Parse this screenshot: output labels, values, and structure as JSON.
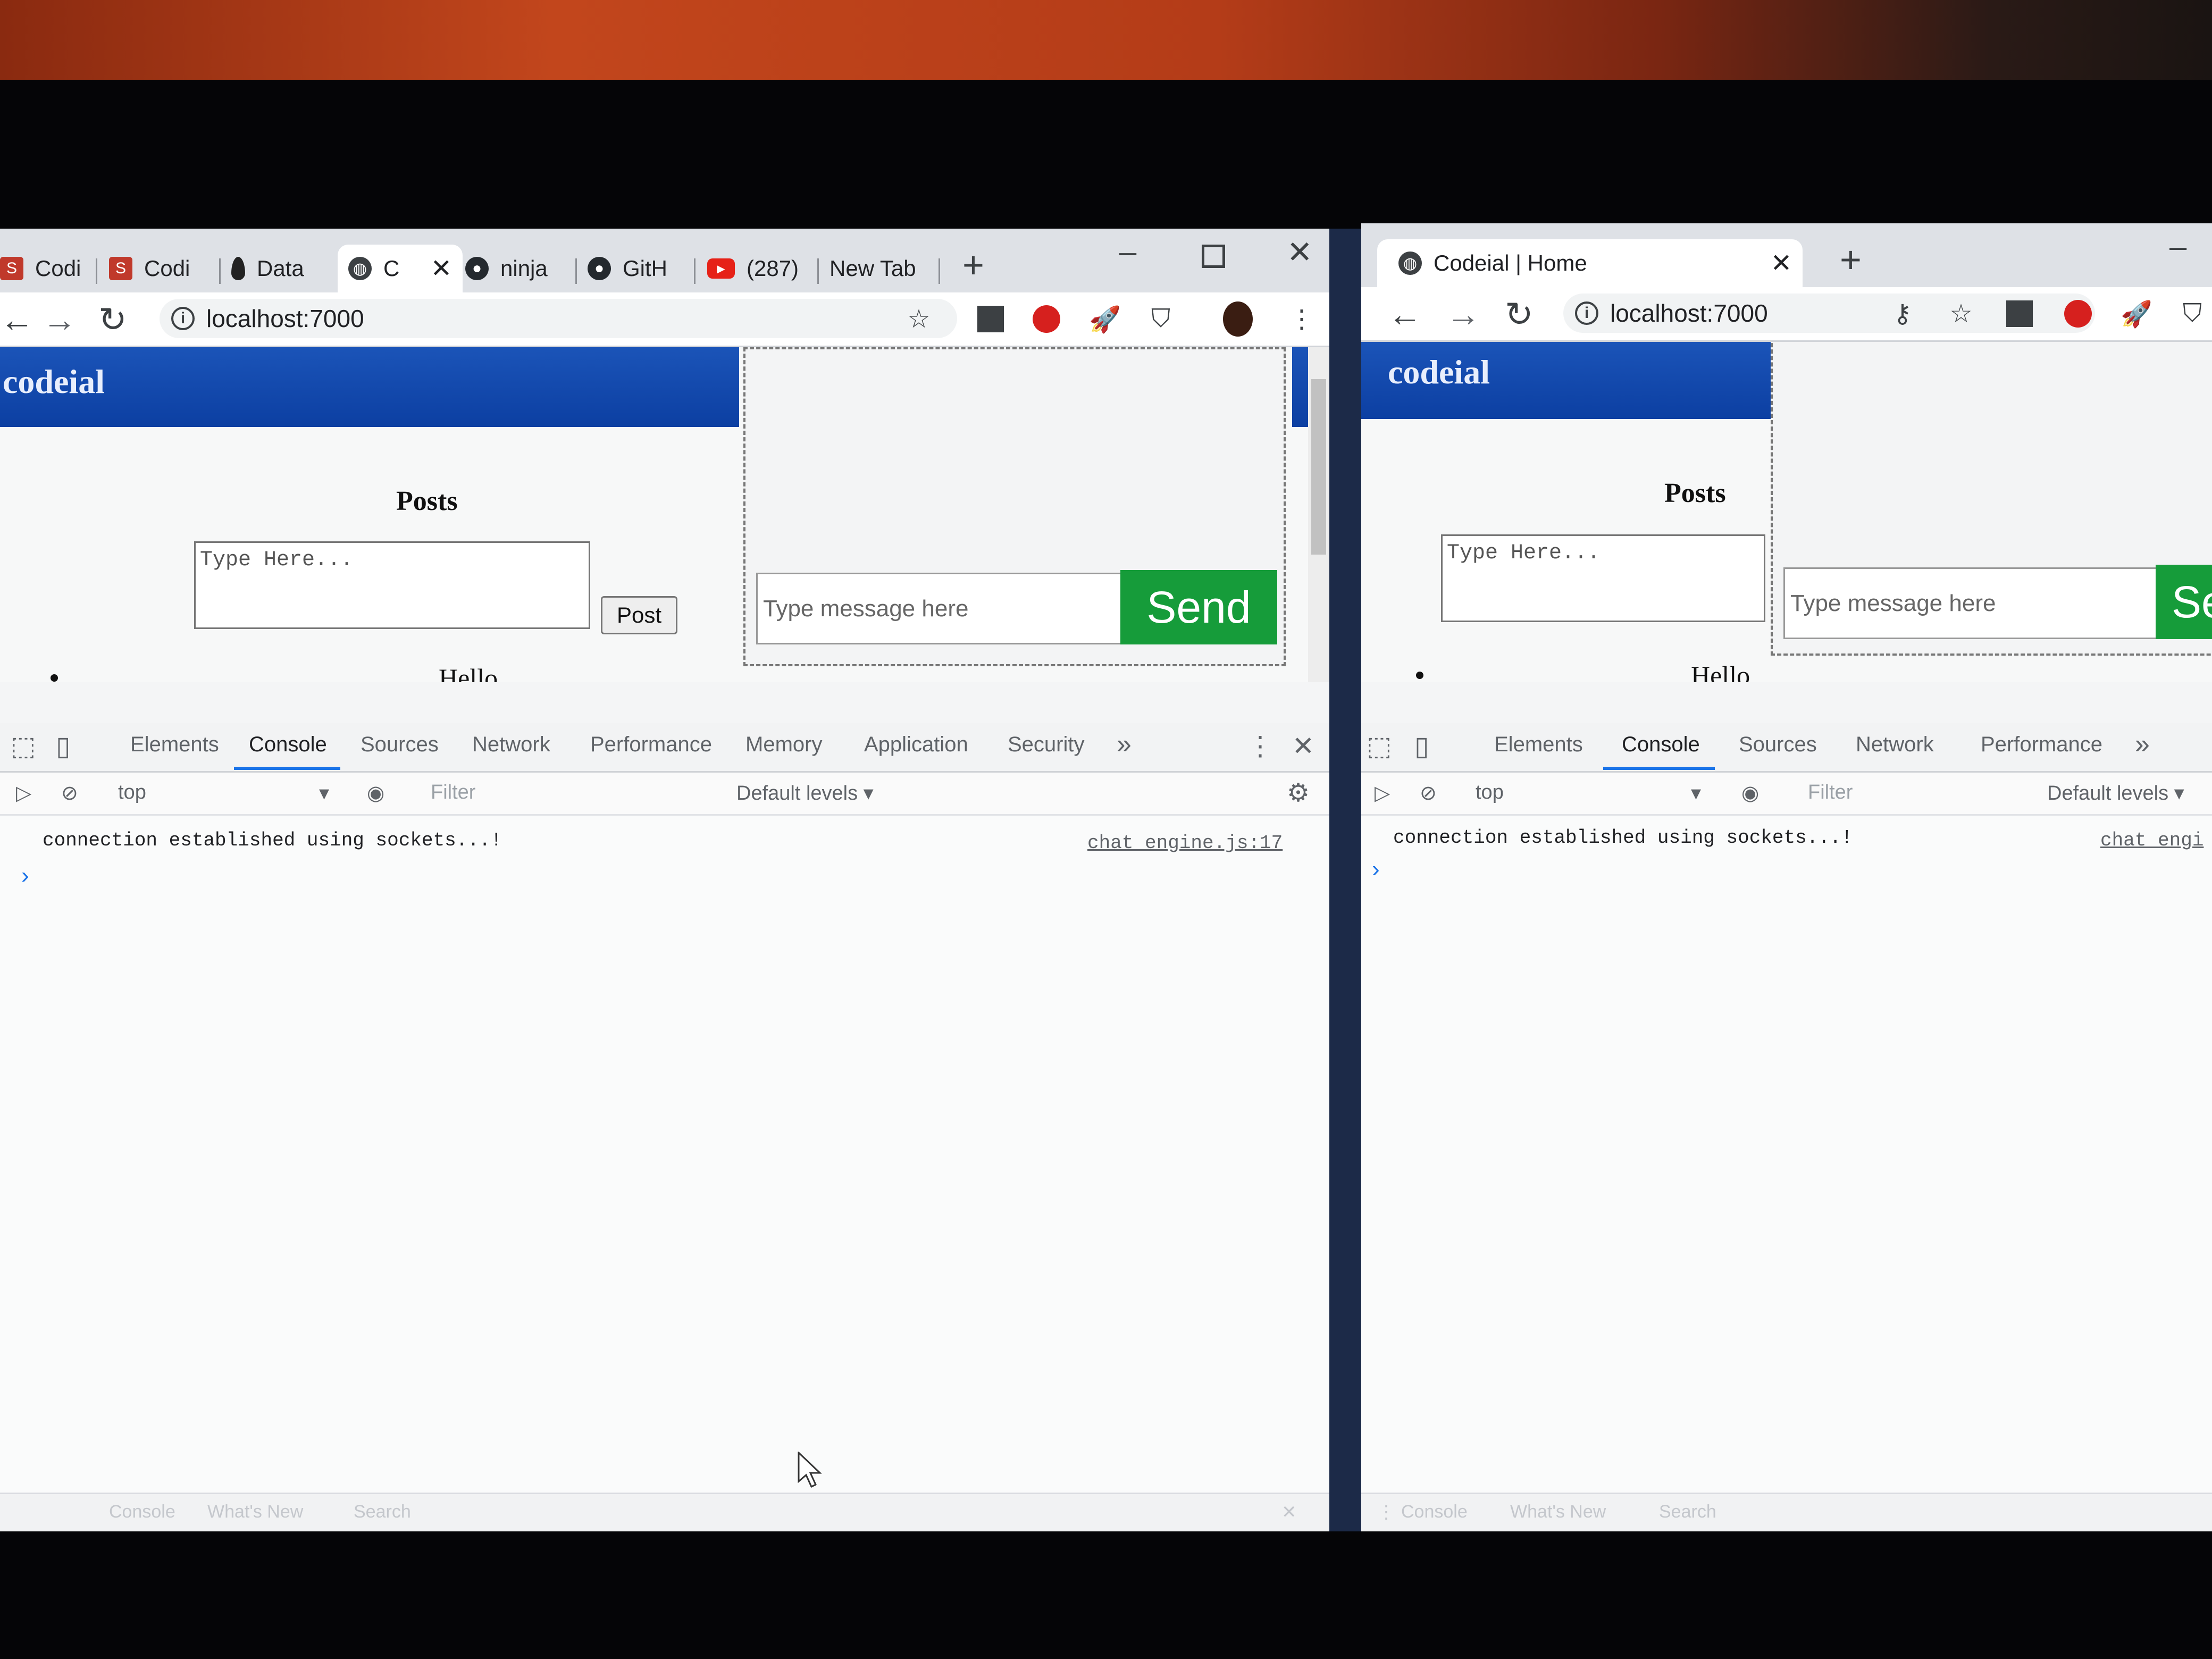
{
  "left_window": {
    "tabs": [
      {
        "label": "Codi",
        "icon": "codingninjas-icon"
      },
      {
        "label": "Codi",
        "icon": "codingninjas-icon"
      },
      {
        "label": "Data",
        "icon": "mongodb-leaf-icon"
      },
      {
        "label": "C",
        "icon": "globe-icon",
        "active": true
      },
      {
        "label": "ninja",
        "icon": "github-icon"
      },
      {
        "label": "GitH",
        "icon": "github-icon"
      },
      {
        "label": "(287)",
        "icon": "youtube-icon"
      },
      {
        "label": "New Tab",
        "icon": ""
      }
    ],
    "url": "localhost:7000",
    "page": {
      "brand": "codeial",
      "posts_title": "Posts",
      "post_placeholder": "Type Here...",
      "post_button": "Post",
      "first_post": "Hello",
      "chat_placeholder": "Type message here",
      "send_label": "Send"
    },
    "devtools": {
      "tabs": [
        "Elements",
        "Console",
        "Sources",
        "Network",
        "Performance",
        "Memory",
        "Application",
        "Security"
      ],
      "active_tab": "Console",
      "context": "top",
      "filter_placeholder": "Filter",
      "levels": "Default levels ▾",
      "log": "connection established using sockets...!",
      "log_source": "chat_engine.js:17",
      "drawer_tabs": [
        "Console",
        "What's New",
        "Search"
      ]
    }
  },
  "right_window": {
    "tab_title": "Codeial | Home",
    "url": "localhost:7000",
    "page": {
      "brand": "codeial",
      "posts_title": "Posts",
      "post_placeholder": "Type Here...",
      "first_post": "Hello",
      "chat_placeholder": "Type message here",
      "send_label": "Se"
    },
    "devtools": {
      "tabs": [
        "Elements",
        "Console",
        "Sources",
        "Network",
        "Performance"
      ],
      "active_tab": "Console",
      "context": "top",
      "filter_placeholder": "Filter",
      "levels": "Default levels ▾",
      "log": "connection established using sockets...!",
      "log_source": "chat_engi",
      "drawer_tabs": [
        "Console",
        "What's New",
        "Search"
      ]
    }
  },
  "colors": {
    "brand_blue": "#0c3fa2",
    "send_green": "#169c3a",
    "devtools_accent": "#1a73e8"
  }
}
